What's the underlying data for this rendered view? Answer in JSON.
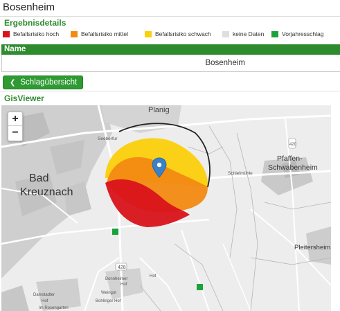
{
  "page": {
    "title": "Bosenheim"
  },
  "details": {
    "title": "Ergebnisdetails",
    "legend": [
      {
        "label": "Befallsrisiko hoch",
        "color": "#d9131b"
      },
      {
        "label": "Befallsrisiko mittel",
        "color": "#f38a12"
      },
      {
        "label": "Befallsrisiko schwach",
        "color": "#fbd00c"
      },
      {
        "label": "keine Daten",
        "color": "#dedede"
      },
      {
        "label": "Vorjahresschlag",
        "color": "#1aa33a"
      }
    ],
    "table": {
      "header": "Name",
      "value": "Bosenheim"
    },
    "back_button_label": "Schlagübersicht"
  },
  "gis": {
    "title": "GisViewer",
    "zoom_in": "+",
    "zoom_out": "−",
    "colors": {
      "accent": "#2e8b2e",
      "marker": "#3b82c4"
    },
    "labels": {
      "planig": "Planig",
      "bad": "Bad",
      "kreuznach": "Kreuznach",
      "pfaffen": "Pfaffen-",
      "schwabenheim": "Schwabenheim",
      "pleitersheim": "Pleitersheim",
      "seeberfur": "Seeberfur",
      "schlefmuhle": "Schlefmühle",
      "bonnheimer": "Bonnheimer",
      "hof1": "Hof",
      "weingut": "Weingut",
      "bohlinger": "Bohlinger Hof",
      "damstadter": "Damstadter",
      "hof2": "Hof",
      "hof3": "Hof",
      "amhof": "Im Rosengarten",
      "road428": "428",
      "road420": "420"
    }
  }
}
